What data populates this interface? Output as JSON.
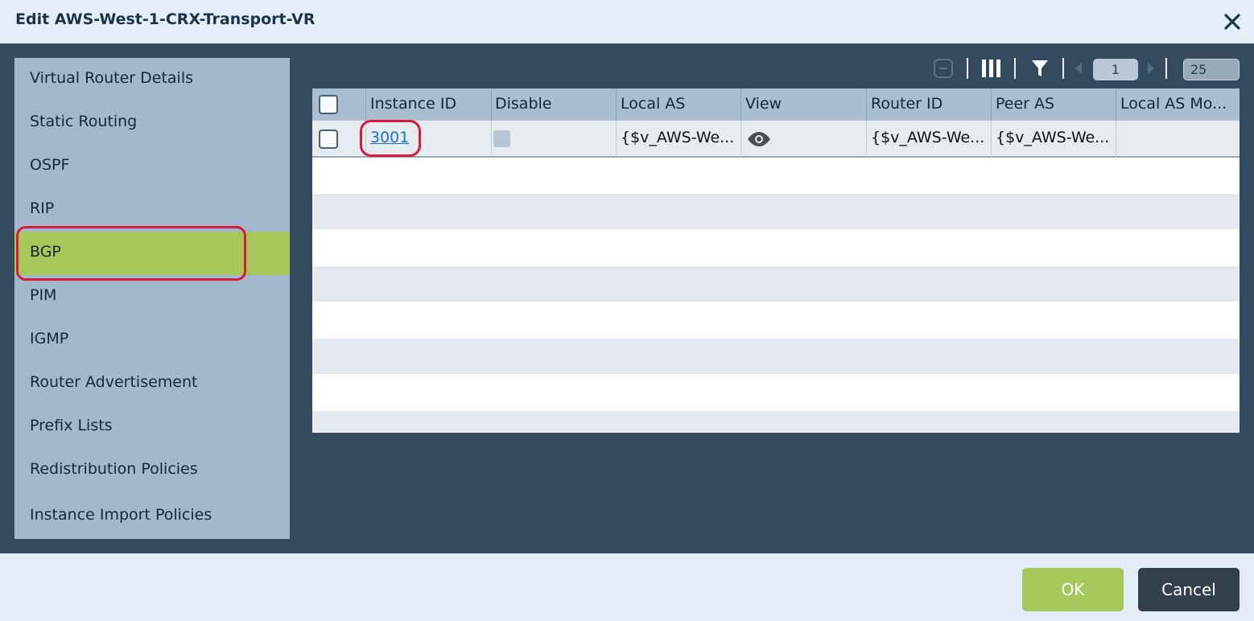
{
  "window": {
    "title": "Edit AWS-West-1-CRX-Transport-VR"
  },
  "sidebar": {
    "items": [
      {
        "label": "Virtual Router Details"
      },
      {
        "label": "Static Routing"
      },
      {
        "label": "OSPF"
      },
      {
        "label": "RIP"
      },
      {
        "label": "BGP",
        "active": true
      },
      {
        "label": "PIM"
      },
      {
        "label": "IGMP"
      },
      {
        "label": "Router Advertisement"
      },
      {
        "label": "Prefix Lists"
      },
      {
        "label": "Redistribution Policies"
      },
      {
        "label": "Instance Import Policies"
      }
    ]
  },
  "toolbar": {
    "icons": [
      "remove-icon",
      "columns-icon",
      "filter-icon",
      "prev-page-icon",
      "next-page-icon"
    ],
    "page_number": "1",
    "page_size": "25"
  },
  "table": {
    "columns": [
      "Instance ID",
      "Disable",
      "Local AS",
      "View",
      "Router ID",
      "Peer AS",
      "Local AS Mo..."
    ],
    "rows": [
      {
        "instance_id": "3001",
        "disable": false,
        "local_as": "{$v_AWS-We...",
        "view_icon": "eye-icon",
        "router_id": "{$v_AWS-We...",
        "peer_as": "{$v_AWS-We...",
        "local_as_mode": ""
      }
    ]
  },
  "footer": {
    "ok_label": "OK",
    "cancel_label": "Cancel"
  },
  "colors": {
    "accent_green": "#a6c75a",
    "dark_panel": "#344a5e",
    "highlight_red": "#d8193b",
    "link_blue": "#1a73c8"
  }
}
